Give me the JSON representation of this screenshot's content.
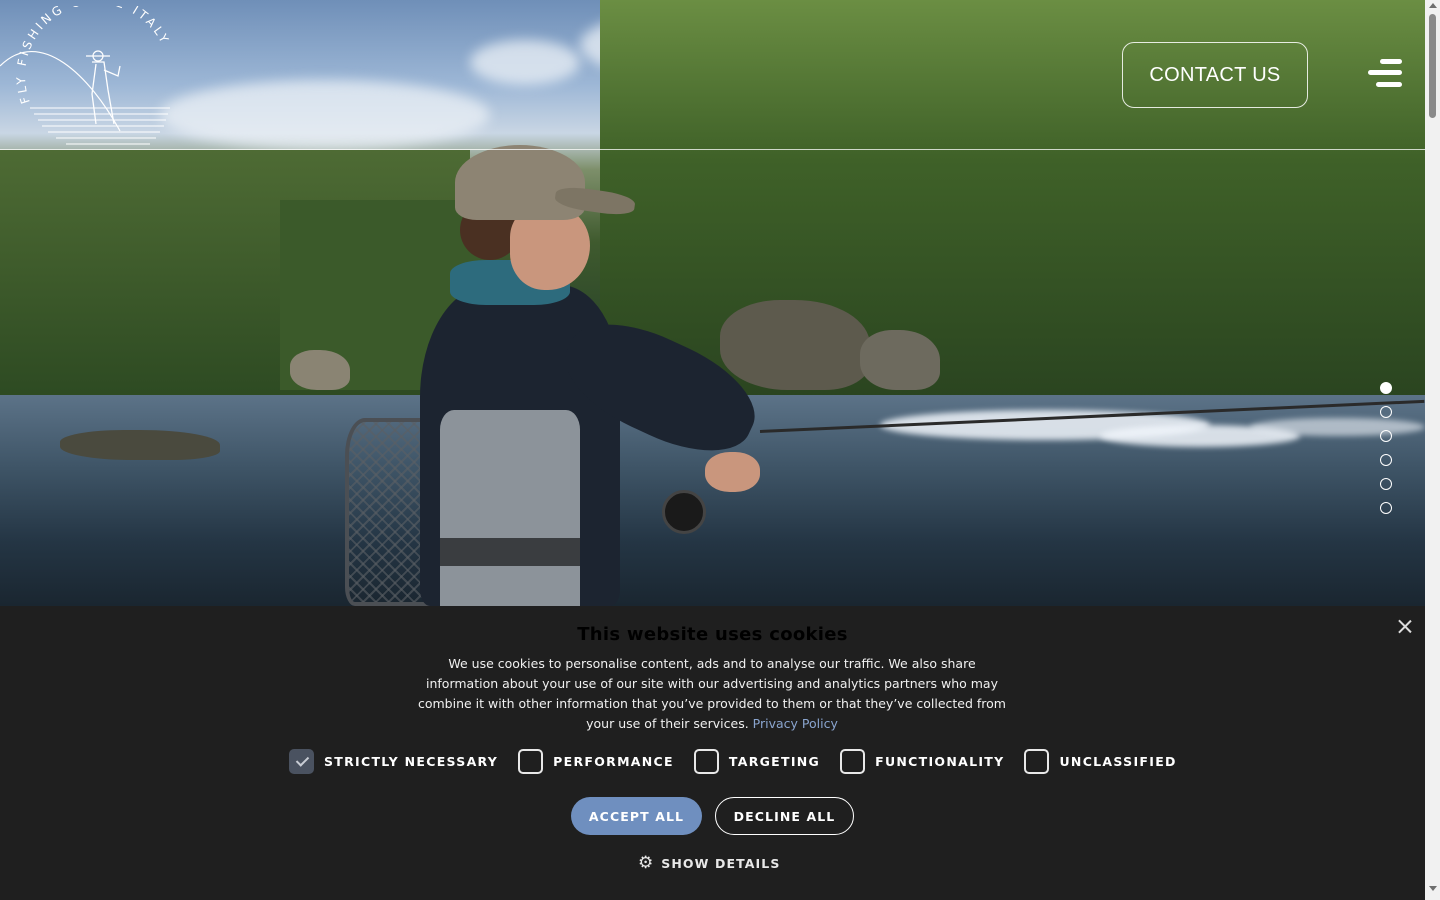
{
  "header": {
    "logo_text": "FLY FISHING GUIDE ITALY",
    "contact_label": "CONTACT US",
    "menu_icon": "hamburger-menu-icon"
  },
  "hero": {
    "slides_count": 6,
    "active_slide": 1
  },
  "cookie_banner": {
    "title": "This website uses cookies",
    "text": "We use cookies to personalise content, ads and to analyse our traffic. We also share information about your use of our site with our advertising and analytics partners who may combine it with other information that you’ve provided to them or that they’ve collected from your use of their services.",
    "privacy_link": "Privacy Policy",
    "options": [
      {
        "label": "STRICTLY NECESSARY",
        "checked": true
      },
      {
        "label": "PERFORMANCE",
        "checked": false
      },
      {
        "label": "TARGETING",
        "checked": false
      },
      {
        "label": "FUNCTIONALITY",
        "checked": false
      },
      {
        "label": "UNCLASSIFIED",
        "checked": false
      }
    ],
    "accept_label": "ACCEPT ALL",
    "decline_label": "DECLINE ALL",
    "details_label": "SHOW DETAILS",
    "details_icon": "gear-icon",
    "close_icon": "close-icon"
  },
  "colors": {
    "banner_bg": "#1f1f1f",
    "accept_bg": "#6f8fbf",
    "link": "#8aa5cf"
  }
}
